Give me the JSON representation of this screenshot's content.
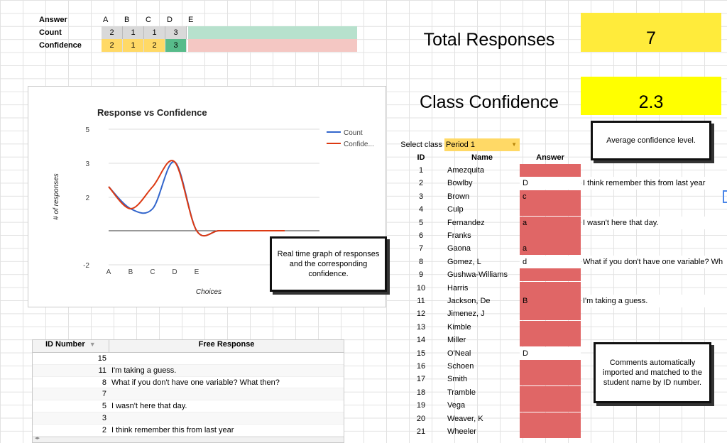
{
  "summary": {
    "row_labels": [
      "Answer",
      "Count",
      "Confidence"
    ],
    "answers": [
      "A",
      "B",
      "C",
      "D",
      "E"
    ],
    "counts": [
      "2",
      "1",
      "1",
      "3"
    ],
    "confidences": [
      "2",
      "1",
      "2",
      "3"
    ]
  },
  "totals": {
    "total_label": "Total Responses",
    "total_value": "7",
    "confidence_label": "Class Confidence",
    "confidence_value": "2.3"
  },
  "chart_data": {
    "type": "line",
    "title": "Response vs Confidence",
    "xlabel": "Choices",
    "ylabel": "# of responses",
    "categories": [
      "A",
      "B",
      "C",
      "D",
      "E",
      "",
      "",
      "",
      ""
    ],
    "yticks": [
      "5",
      "3",
      "2",
      "-2"
    ],
    "series": [
      {
        "name": "Count",
        "color": "#3366cc",
        "values": [
          2,
          1,
          1,
          3,
          0,
          0,
          0,
          0,
          0
        ]
      },
      {
        "name": "Confide...",
        "color": "#dc3912",
        "values": [
          2,
          1,
          2,
          3,
          0,
          0,
          0,
          0,
          0
        ]
      }
    ]
  },
  "callouts": {
    "graph": "Real time graph of responses and the corresponding confidence.",
    "average": "Average confidence level.",
    "comments": "Comments automatically imported and matched to the student name by ID number."
  },
  "roster": {
    "select_label": "Select class",
    "period": "Period 1",
    "headers": [
      "ID",
      "Name",
      "Answer"
    ],
    "rows": [
      {
        "id": "1",
        "name": "Amezquita",
        "answer": "",
        "comment": "",
        "red": true
      },
      {
        "id": "2",
        "name": "Bowlby",
        "answer": "D",
        "comment": "I think remember this from last year",
        "red": false
      },
      {
        "id": "3",
        "name": "Brown",
        "answer": "c",
        "comment": "",
        "red": true
      },
      {
        "id": "4",
        "name": "Culp",
        "answer": "",
        "comment": "",
        "red": true
      },
      {
        "id": "5",
        "name": "Fernandez",
        "answer": "a",
        "comment": "I wasn't here that day.",
        "red": true
      },
      {
        "id": "6",
        "name": "Franks",
        "answer": "",
        "comment": "",
        "red": true
      },
      {
        "id": "7",
        "name": "Gaona",
        "answer": "a",
        "comment": "",
        "red": true
      },
      {
        "id": "8",
        "name": "Gomez, L",
        "answer": "d",
        "comment": "What if you don't have one variable? Wh",
        "red": false
      },
      {
        "id": "9",
        "name": "Gushwa-Williams",
        "answer": "",
        "comment": "",
        "red": true
      },
      {
        "id": "10",
        "name": "Harris",
        "answer": "",
        "comment": "",
        "red": true
      },
      {
        "id": "11",
        "name": "Jackson, De",
        "answer": "B",
        "comment": "I'm taking a guess.",
        "red": true
      },
      {
        "id": "12",
        "name": "Jimenez, J",
        "answer": "",
        "comment": "",
        "red": true
      },
      {
        "id": "13",
        "name": "Kimble",
        "answer": "",
        "comment": "",
        "red": true
      },
      {
        "id": "14",
        "name": "Miller",
        "answer": "",
        "comment": "",
        "red": true
      },
      {
        "id": "15",
        "name": "O'Neal",
        "answer": "D",
        "comment": "",
        "red": false
      },
      {
        "id": "16",
        "name": "Schoen",
        "answer": "",
        "comment": "",
        "red": true
      },
      {
        "id": "17",
        "name": "Smith",
        "answer": "",
        "comment": "",
        "red": true
      },
      {
        "id": "18",
        "name": "Tramble",
        "answer": "",
        "comment": "",
        "red": true
      },
      {
        "id": "19",
        "name": "Vega",
        "answer": "",
        "comment": "",
        "red": true
      },
      {
        "id": "20",
        "name": "Weaver, K",
        "answer": "",
        "comment": "",
        "red": true
      },
      {
        "id": "21",
        "name": "Wheeler",
        "answer": "",
        "comment": "",
        "red": true
      }
    ]
  },
  "free_response": {
    "headers": [
      "ID Number",
      "Free Response"
    ],
    "sort_icon": "sort-down-icon",
    "rows": [
      {
        "id": "15",
        "text": ""
      },
      {
        "id": "11",
        "text": "I'm taking a guess."
      },
      {
        "id": "8",
        "text": "What if you don't have one variable? What then?"
      },
      {
        "id": "7",
        "text": ""
      },
      {
        "id": "5",
        "text": "I wasn't here that day."
      },
      {
        "id": "3",
        "text": ""
      },
      {
        "id": "2",
        "text": "I think remember this from last year"
      }
    ]
  }
}
